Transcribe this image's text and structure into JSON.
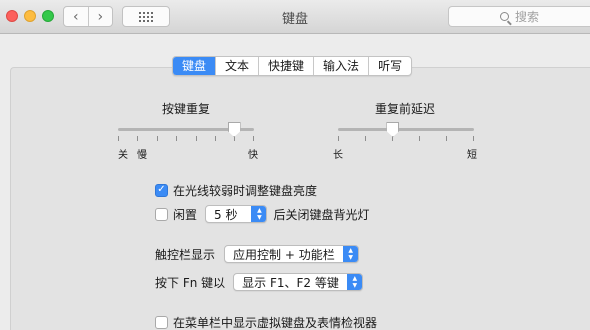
{
  "window": {
    "title": "键盘",
    "search_placeholder": "搜索",
    "nav_back": "‹",
    "nav_forward": "›"
  },
  "tabs": [
    {
      "label": "键盘",
      "active": true
    },
    {
      "label": "文本",
      "active": false
    },
    {
      "label": "快捷键",
      "active": false
    },
    {
      "label": "输入法",
      "active": false
    },
    {
      "label": "听写",
      "active": false
    }
  ],
  "sliders": {
    "key_repeat": {
      "label": "按键重复",
      "min_labels": [
        "关",
        "慢"
      ],
      "max_label": "快",
      "level": 0.85
    },
    "delay_until_repeat": {
      "label": "重复前延迟",
      "min_label": "长",
      "max_label": "短",
      "level": 0.4
    }
  },
  "options": {
    "adjust_brightness": {
      "label": "在光线较弱时调整键盘亮度",
      "checked": true
    },
    "backlight_off": {
      "label_before": "闲置",
      "value": "5 秒",
      "label_after": "后关闭键盘背光灯",
      "checked": false
    },
    "touch_bar": {
      "label": "触控栏显示",
      "value": "应用控制 + 功能栏"
    },
    "fn_key": {
      "label": "按下 Fn 键以",
      "value": "显示 F1、F2 等键"
    },
    "show_viewers": {
      "label": "在菜单栏中显示虚拟键盘及表情检视器",
      "checked": false
    }
  },
  "colors": {
    "accent": "#3b8bf5",
    "window_bg": "#ececec",
    "panel_bg": "#e3e3e3"
  },
  "icons": {
    "search": "search-icon",
    "stepper": "up-down-chevron-icon",
    "check": "checkmark-icon"
  }
}
